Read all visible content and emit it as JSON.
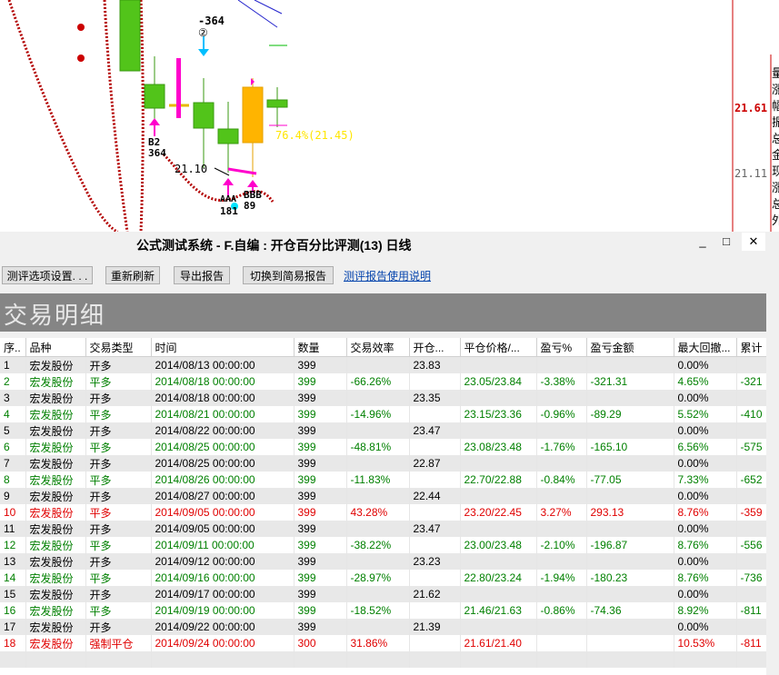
{
  "chart": {
    "labels": {
      "neg364": "-364",
      "circle2": "②",
      "b2": "B2",
      "b2_val": "364",
      "pct": "76.4%(21.45)",
      "price_low": "21.10",
      "aaa": "AAA",
      "aaa_val": "181",
      "bbb": "BBB",
      "bbb_val": "89",
      "axis_hi": "21.61",
      "axis_lo": "21.11"
    },
    "right_chars": [
      "量",
      "涨",
      "幅",
      "振",
      "总",
      "金",
      "现",
      "涨",
      "总",
      "外"
    ]
  },
  "window": {
    "title": "公式测试系统 - F.自编 : 开仓百分比评测(13) 日线",
    "minimize": "_",
    "maximize": "□",
    "close": "✕"
  },
  "toolbar": {
    "btn1": "测评选项设置. . .",
    "btn2": "重新刷新",
    "btn3": "导出报告",
    "btn4": "切换到简易报告",
    "link": "测评报告使用说明"
  },
  "banner": "交易明细",
  "table": {
    "headers": [
      "序..",
      "品种",
      "交易类型",
      "时间",
      "数量",
      "交易效率",
      "开仓...",
      "平仓价格/...",
      "盈亏%",
      "盈亏金额",
      "最大回撤...",
      "累计"
    ],
    "rows": [
      {
        "color": "black",
        "cells": [
          "1",
          "宏发股份",
          "开多",
          "2014/08/13 00:00:00",
          "399",
          "",
          "23.83",
          "",
          "",
          "",
          "0.00%",
          ""
        ]
      },
      {
        "color": "green",
        "cells": [
          "2",
          "宏发股份",
          "平多",
          "2014/08/18 00:00:00",
          "399",
          "-66.26%",
          "",
          "23.05/23.84",
          "-3.38%",
          "-321.31",
          "4.65%",
          "-321"
        ]
      },
      {
        "color": "black",
        "cells": [
          "3",
          "宏发股份",
          "开多",
          "2014/08/18 00:00:00",
          "399",
          "",
          "23.35",
          "",
          "",
          "",
          "0.00%",
          ""
        ]
      },
      {
        "color": "green",
        "cells": [
          "4",
          "宏发股份",
          "平多",
          "2014/08/21 00:00:00",
          "399",
          "-14.96%",
          "",
          "23.15/23.36",
          "-0.96%",
          "-89.29",
          "5.52%",
          "-410"
        ]
      },
      {
        "color": "black",
        "cells": [
          "5",
          "宏发股份",
          "开多",
          "2014/08/22 00:00:00",
          "399",
          "",
          "23.47",
          "",
          "",
          "",
          "0.00%",
          ""
        ]
      },
      {
        "color": "green",
        "cells": [
          "6",
          "宏发股份",
          "平多",
          "2014/08/25 00:00:00",
          "399",
          "-48.81%",
          "",
          "23.08/23.48",
          "-1.76%",
          "-165.10",
          "6.56%",
          "-575"
        ]
      },
      {
        "color": "black",
        "cells": [
          "7",
          "宏发股份",
          "开多",
          "2014/08/25 00:00:00",
          "399",
          "",
          "22.87",
          "",
          "",
          "",
          "0.00%",
          ""
        ]
      },
      {
        "color": "green",
        "cells": [
          "8",
          "宏发股份",
          "平多",
          "2014/08/26 00:00:00",
          "399",
          "-11.83%",
          "",
          "22.70/22.88",
          "-0.84%",
          "-77.05",
          "7.33%",
          "-652"
        ]
      },
      {
        "color": "black",
        "cells": [
          "9",
          "宏发股份",
          "开多",
          "2014/08/27 00:00:00",
          "399",
          "",
          "22.44",
          "",
          "",
          "",
          "0.00%",
          ""
        ]
      },
      {
        "color": "red",
        "cells": [
          "10",
          "宏发股份",
          "平多",
          "2014/09/05 00:00:00",
          "399",
          "43.28%",
          "",
          "23.20/22.45",
          "3.27%",
          "293.13",
          "8.76%",
          "-359"
        ]
      },
      {
        "color": "black",
        "cells": [
          "11",
          "宏发股份",
          "开多",
          "2014/09/05 00:00:00",
          "399",
          "",
          "23.47",
          "",
          "",
          "",
          "0.00%",
          ""
        ]
      },
      {
        "color": "green",
        "cells": [
          "12",
          "宏发股份",
          "平多",
          "2014/09/11 00:00:00",
          "399",
          "-38.22%",
          "",
          "23.00/23.48",
          "-2.10%",
          "-196.87",
          "8.76%",
          "-556"
        ]
      },
      {
        "color": "black",
        "cells": [
          "13",
          "宏发股份",
          "开多",
          "2014/09/12 00:00:00",
          "399",
          "",
          "23.23",
          "",
          "",
          "",
          "0.00%",
          ""
        ]
      },
      {
        "color": "green",
        "cells": [
          "14",
          "宏发股份",
          "平多",
          "2014/09/16 00:00:00",
          "399",
          "-28.97%",
          "",
          "22.80/23.24",
          "-1.94%",
          "-180.23",
          "8.76%",
          "-736"
        ]
      },
      {
        "color": "black",
        "cells": [
          "15",
          "宏发股份",
          "开多",
          "2014/09/17 00:00:00",
          "399",
          "",
          "21.62",
          "",
          "",
          "",
          "0.00%",
          ""
        ]
      },
      {
        "color": "green",
        "cells": [
          "16",
          "宏发股份",
          "平多",
          "2014/09/19 00:00:00",
          "399",
          "-18.52%",
          "",
          "21.46/21.63",
          "-0.86%",
          "-74.36",
          "8.92%",
          "-811"
        ]
      },
      {
        "color": "black",
        "cells": [
          "17",
          "宏发股份",
          "开多",
          "2014/09/22 00:00:00",
          "399",
          "",
          "21.39",
          "",
          "",
          "",
          "0.00%",
          ""
        ]
      },
      {
        "color": "red",
        "cells": [
          "18",
          "宏发股份",
          "强制平仓",
          "2014/09/24 00:00:00",
          "300",
          "31.86%",
          "",
          "21.61/21.40",
          "",
          "",
          "10.53%",
          "-811"
        ]
      }
    ]
  }
}
